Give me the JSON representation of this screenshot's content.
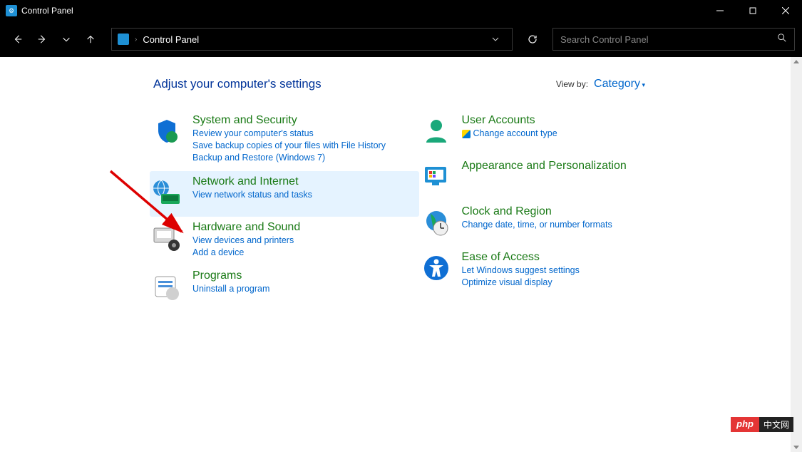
{
  "window": {
    "title": "Control Panel"
  },
  "address": {
    "path": "Control Panel"
  },
  "search": {
    "placeholder": "Search Control Panel"
  },
  "header": {
    "title": "Adjust your computer's settings",
    "viewby_label": "View by:",
    "viewby_value": "Category"
  },
  "left": [
    {
      "id": "system-security",
      "title": "System and Security",
      "links": [
        "Review your computer's status",
        "Save backup copies of your files with File History",
        "Backup and Restore (Windows 7)"
      ]
    },
    {
      "id": "network-internet",
      "title": "Network and Internet",
      "highlight": true,
      "links": [
        "View network status and tasks"
      ]
    },
    {
      "id": "hardware-sound",
      "title": "Hardware and Sound",
      "links": [
        "View devices and printers",
        "Add a device"
      ]
    },
    {
      "id": "programs",
      "title": "Programs",
      "links": [
        "Uninstall a program"
      ]
    }
  ],
  "right": [
    {
      "id": "user-accounts",
      "title": "User Accounts",
      "links": [
        "Change account type"
      ],
      "shield": [
        true
      ]
    },
    {
      "id": "appearance",
      "title": "Appearance and Personalization",
      "links": []
    },
    {
      "id": "clock-region",
      "title": "Clock and Region",
      "links": [
        "Change date, time, or number formats"
      ]
    },
    {
      "id": "ease-access",
      "title": "Ease of Access",
      "links": [
        "Let Windows suggest settings",
        "Optimize visual display"
      ]
    }
  ],
  "watermark": {
    "left": "php",
    "right": "中文网"
  }
}
